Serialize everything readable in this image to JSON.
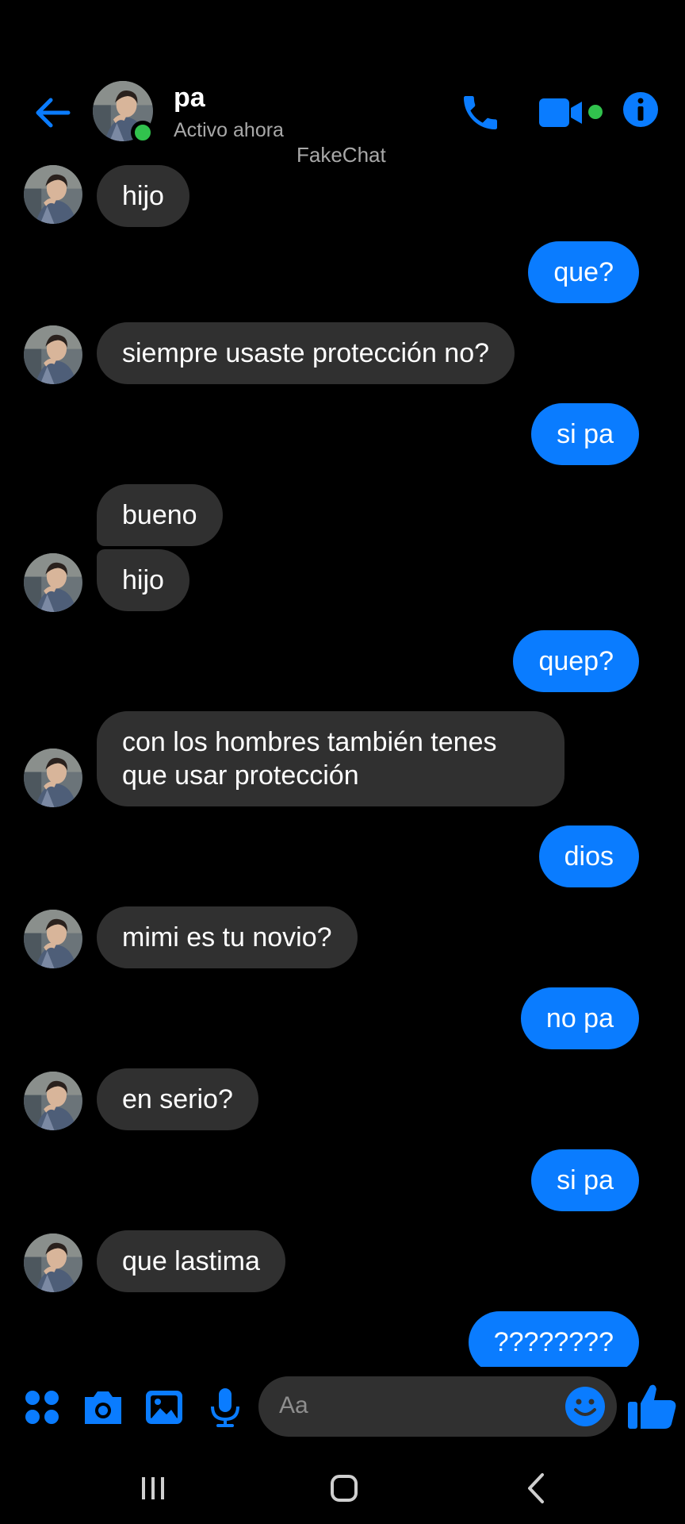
{
  "header": {
    "contact_name": "pa",
    "status": "Activo ahora",
    "watermark": "FakeChat"
  },
  "messages": [
    {
      "side": "in",
      "text": "hijo",
      "avatar": true
    },
    {
      "side": "out",
      "text": "que?"
    },
    {
      "side": "in",
      "text": "siempre usaste protección no?",
      "avatar": true
    },
    {
      "side": "out",
      "text": "si pa"
    },
    {
      "side": "in",
      "text": "bueno",
      "avatar": false
    },
    {
      "side": "in",
      "text": "hijo",
      "avatar": true
    },
    {
      "side": "out",
      "text": "quep?"
    },
    {
      "side": "in",
      "text": "con los hombres también tenes",
      "text2": "que usar protección",
      "avatar": true
    },
    {
      "side": "out",
      "text": "dios"
    },
    {
      "side": "in",
      "text": "mimi es tu novio?",
      "avatar": true
    },
    {
      "side": "out",
      "text": "no pa"
    },
    {
      "side": "in",
      "text": "en serio?",
      "avatar": true
    },
    {
      "side": "out",
      "text": "si pa"
    },
    {
      "side": "in",
      "text": "que lastima",
      "avatar": true
    },
    {
      "side": "out",
      "text": "????????"
    }
  ],
  "composer": {
    "placeholder": "Aa"
  },
  "colors": {
    "accent": "#0a7cff",
    "incoming_bubble": "#303030",
    "online": "#31c24d",
    "background": "#000000"
  },
  "icons": [
    "back-arrow-icon",
    "phone-icon",
    "video-camera-icon",
    "info-icon",
    "menu-dots-icon",
    "camera-icon",
    "gallery-icon",
    "microphone-icon",
    "emoji-icon",
    "thumbs-up-icon",
    "recent-apps-icon",
    "home-icon",
    "nav-back-icon"
  ]
}
